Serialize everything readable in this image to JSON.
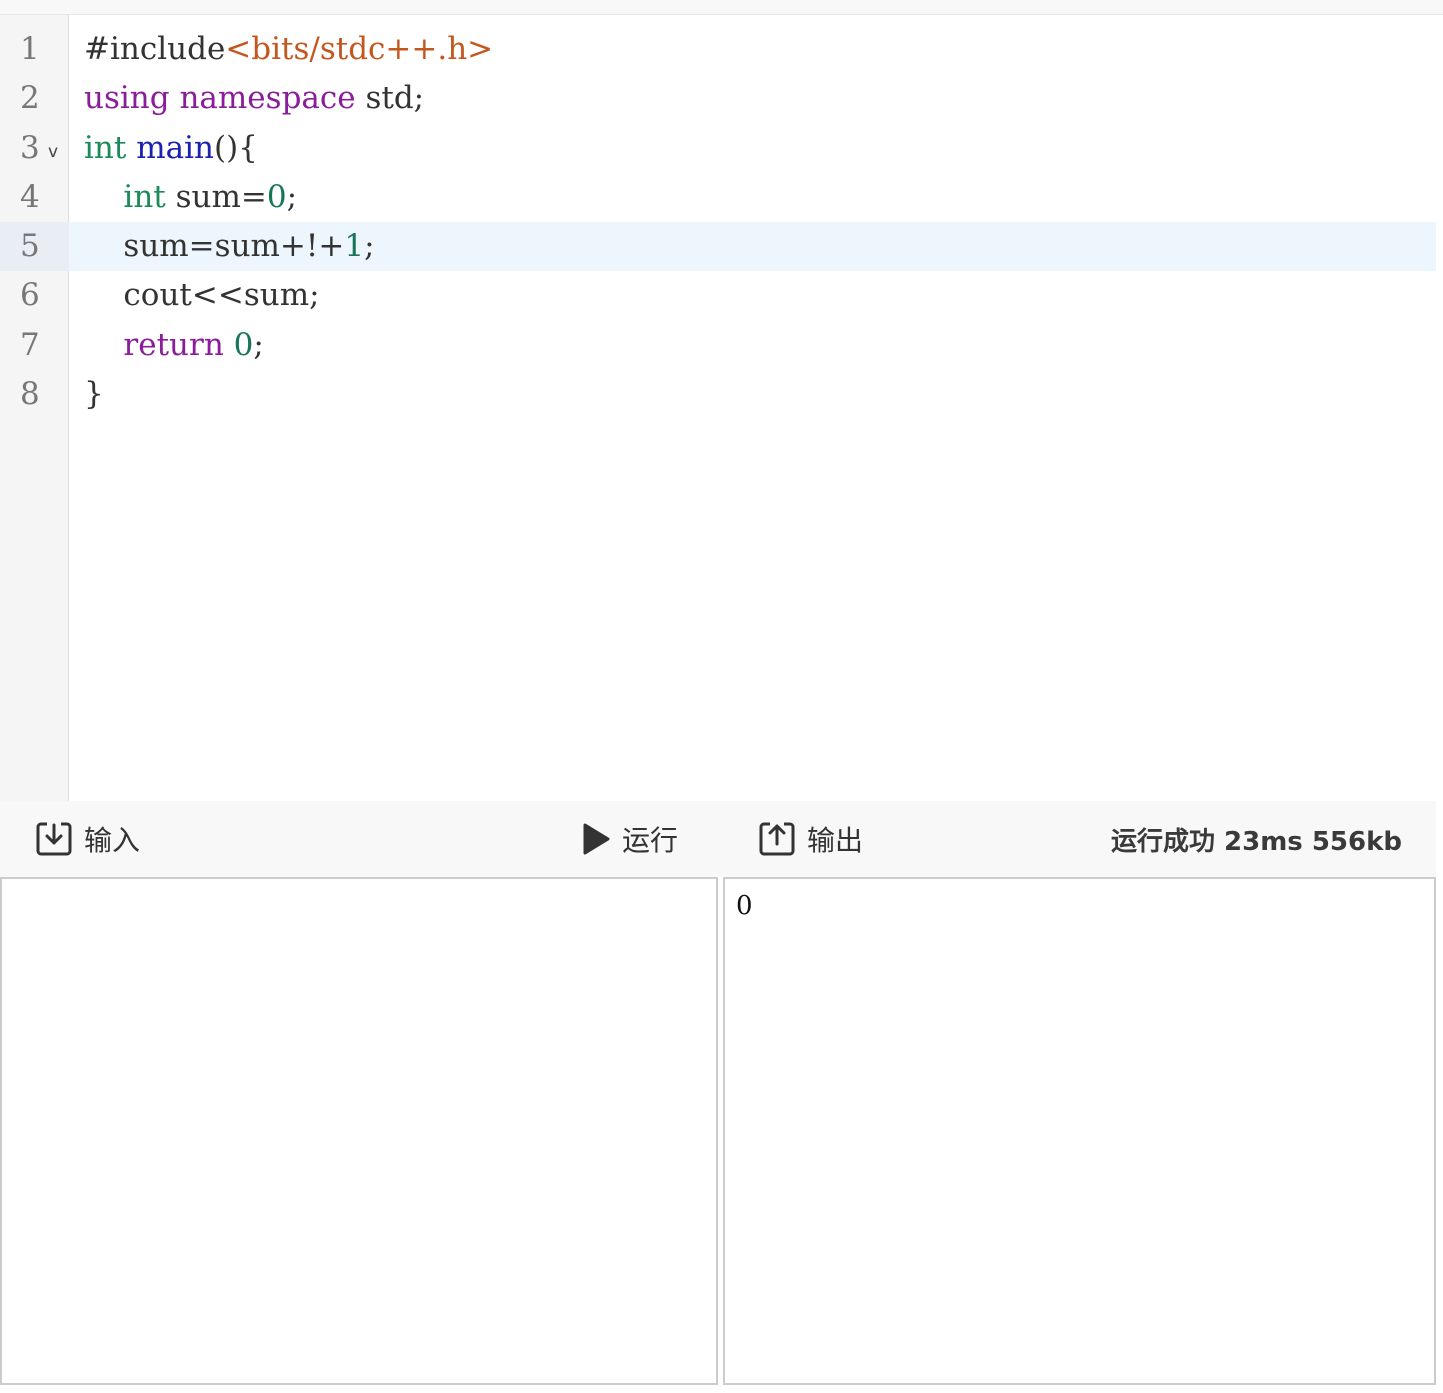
{
  "editor": {
    "lines": [
      {
        "num": "1",
        "segments": [
          {
            "text": "#include",
            "cls": ""
          },
          {
            "text": "<bits/stdc++.h>",
            "cls": "str"
          }
        ]
      },
      {
        "num": "2",
        "segments": [
          {
            "text": "using",
            "cls": "kw-purple"
          },
          {
            "text": " ",
            "cls": ""
          },
          {
            "text": "namespace",
            "cls": "kw-purple"
          },
          {
            "text": " std;",
            "cls": ""
          }
        ]
      },
      {
        "num": "3",
        "fold": "v",
        "segments": [
          {
            "text": "int",
            "cls": "kw-type"
          },
          {
            "text": " ",
            "cls": ""
          },
          {
            "text": "main",
            "cls": "kw-func"
          },
          {
            "text": "(){",
            "cls": ""
          }
        ]
      },
      {
        "num": "4",
        "segments": [
          {
            "text": "    ",
            "cls": ""
          },
          {
            "text": "int",
            "cls": "kw-type"
          },
          {
            "text": " sum=",
            "cls": ""
          },
          {
            "text": "0",
            "cls": "num-lit"
          },
          {
            "text": ";",
            "cls": ""
          }
        ]
      },
      {
        "num": "5",
        "active": true,
        "segments": [
          {
            "text": "    sum=sum+!+",
            "cls": ""
          },
          {
            "text": "1",
            "cls": "num-lit"
          },
          {
            "text": ";",
            "cls": ""
          }
        ]
      },
      {
        "num": "6",
        "segments": [
          {
            "text": "    cout<<sum;",
            "cls": ""
          }
        ]
      },
      {
        "num": "7",
        "segments": [
          {
            "text": "    ",
            "cls": ""
          },
          {
            "text": "return",
            "cls": "kw-purple"
          },
          {
            "text": " ",
            "cls": ""
          },
          {
            "text": "0",
            "cls": "num-lit"
          },
          {
            "text": ";",
            "cls": ""
          }
        ]
      },
      {
        "num": "8",
        "segments": [
          {
            "text": "}",
            "cls": ""
          }
        ]
      }
    ]
  },
  "toolbar": {
    "input_label": "输入",
    "run_label": "运行",
    "output_label": "输出",
    "status": "运行成功 23ms 556kb"
  },
  "io": {
    "input_value": "",
    "output_value": "0"
  },
  "icons": {
    "input": "download-box-icon",
    "run": "play-icon",
    "output": "upload-box-icon"
  }
}
